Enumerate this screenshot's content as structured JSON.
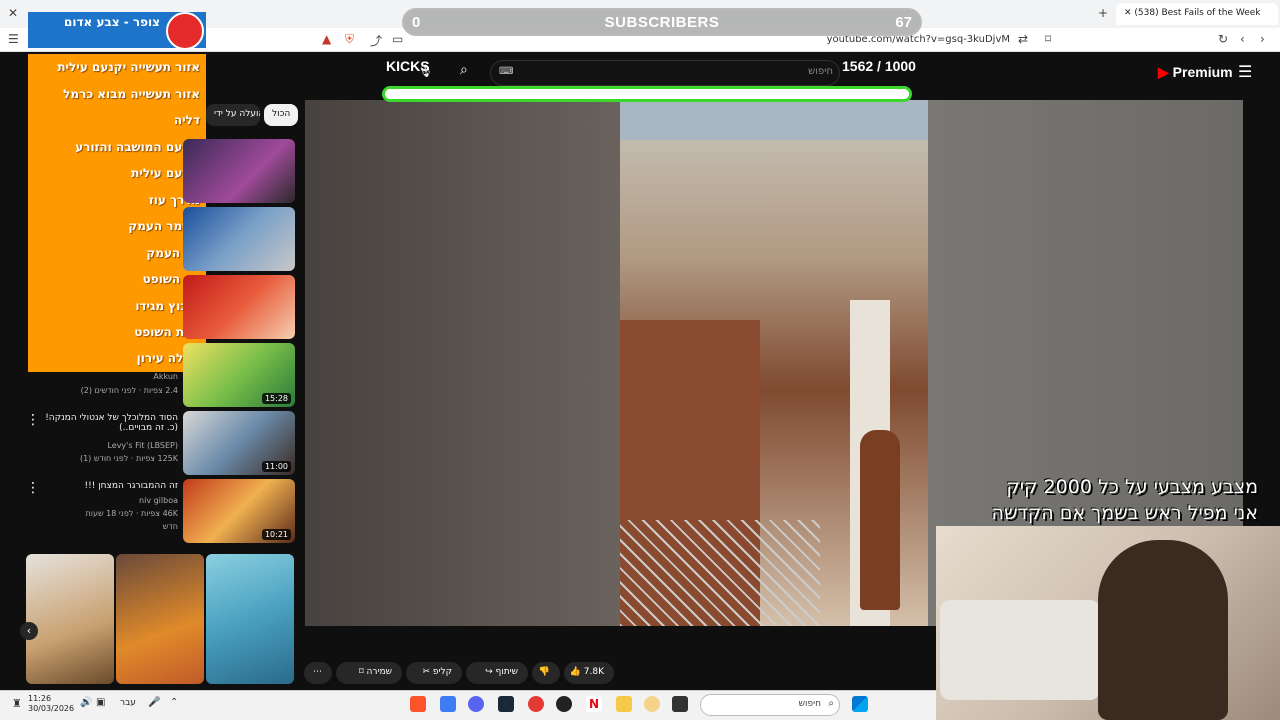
{
  "browser": {
    "tab_title": "(538) Best Fails of the Week",
    "url": "youtube.com/watch?v=gsq-3kuDjvM",
    "new_tab_icon": "plus-icon"
  },
  "overlay": {
    "subscribers_label": "SUBSCRIBERS",
    "subscribers_left": "0",
    "subscribers_right": "67",
    "kicks_label": "KICKS",
    "kicks_goal": "1562 / 1000",
    "kicks_progress": 1.0,
    "donation_text_line1": "מצבע מצבעי על כל 2000 קיק",
    "donation_text_line2": "אני  מפיל ראש בשמך  אם הקדשה"
  },
  "alert_widget": {
    "title": "צופר - צבע אדום",
    "items": [
      "אזור תעשייה יקנעם עילית",
      "אזור תעשייה מבוא כרמל",
      "דליה",
      "יקנעם המושבה והזורע",
      "יקנעם עילית",
      "מדרך עוז",
      "משמר העמק",
      "עין העמק",
      "עין השופט",
      "קיבוץ מגידו",
      "רמת השופט",
      "מעלה עירון"
    ]
  },
  "youtube": {
    "search_placeholder": "חיפוש",
    "premium_label": "Premium",
    "chips": [
      "הכול",
      "הועלה על ידי"
    ],
    "videos": [
      {
        "title": "",
        "meta1": "",
        "meta2": "",
        "duration": ""
      },
      {
        "title": "",
        "meta1": "",
        "meta2": "",
        "duration": ""
      },
      {
        "title": "",
        "meta1": "",
        "meta2": "",
        "duration": ""
      },
      {
        "title": "",
        "channel": "Akkun",
        "meta": "2.4 צפיות · לפני חודשים (2)",
        "duration": "15:28"
      },
      {
        "title": "הסוד המלוכלך של אנטולי המנקה! (כ. זה מבויים..)",
        "channel": "Levy's Fit (LBSEP)",
        "meta": "125K צפיות · לפני חודש (1)",
        "duration": "11:00"
      },
      {
        "title": "זה ההמבורגר המצחן !!!",
        "channel": "niv gilboa",
        "meta": "46K צפיות · לפני 18 שעות",
        "badge": "חדש",
        "duration": "10:21"
      }
    ],
    "actions": {
      "like_count": "7.8K",
      "share": "שיתוף",
      "clip": "קליפ",
      "save": "שמירה"
    }
  },
  "taskbar": {
    "time": "11:26",
    "date": "30/03/2026",
    "language": "עבר",
    "search_label": "חיפוש"
  }
}
